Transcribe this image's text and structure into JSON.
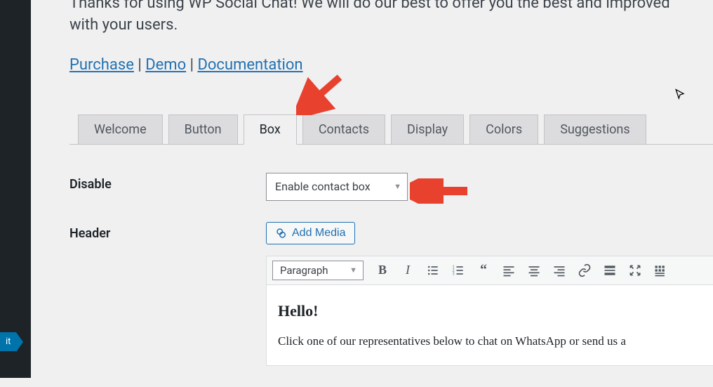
{
  "sidebar": {
    "active_label": "it"
  },
  "intro": {
    "line1": "Thanks for using WP Social Chat! We will do our best to offer you the best and improved",
    "line2": "with your users."
  },
  "links": {
    "purchase": "Purchase",
    "demo": "Demo",
    "documentation": "Documentation",
    "sep": " | "
  },
  "tabs": [
    {
      "label": "Welcome",
      "active": false
    },
    {
      "label": "Button",
      "active": false
    },
    {
      "label": "Box",
      "active": true
    },
    {
      "label": "Contacts",
      "active": false
    },
    {
      "label": "Display",
      "active": false
    },
    {
      "label": "Colors",
      "active": false
    },
    {
      "label": "Suggestions",
      "active": false
    }
  ],
  "fields": {
    "disable": {
      "label": "Disable",
      "value": "Enable contact box"
    },
    "header": {
      "label": "Header"
    }
  },
  "editor": {
    "add_media": "Add Media",
    "format": "Paragraph",
    "content_heading": "Hello!",
    "content_body": "Click one of our representatives below to chat on WhatsApp or send us a"
  }
}
